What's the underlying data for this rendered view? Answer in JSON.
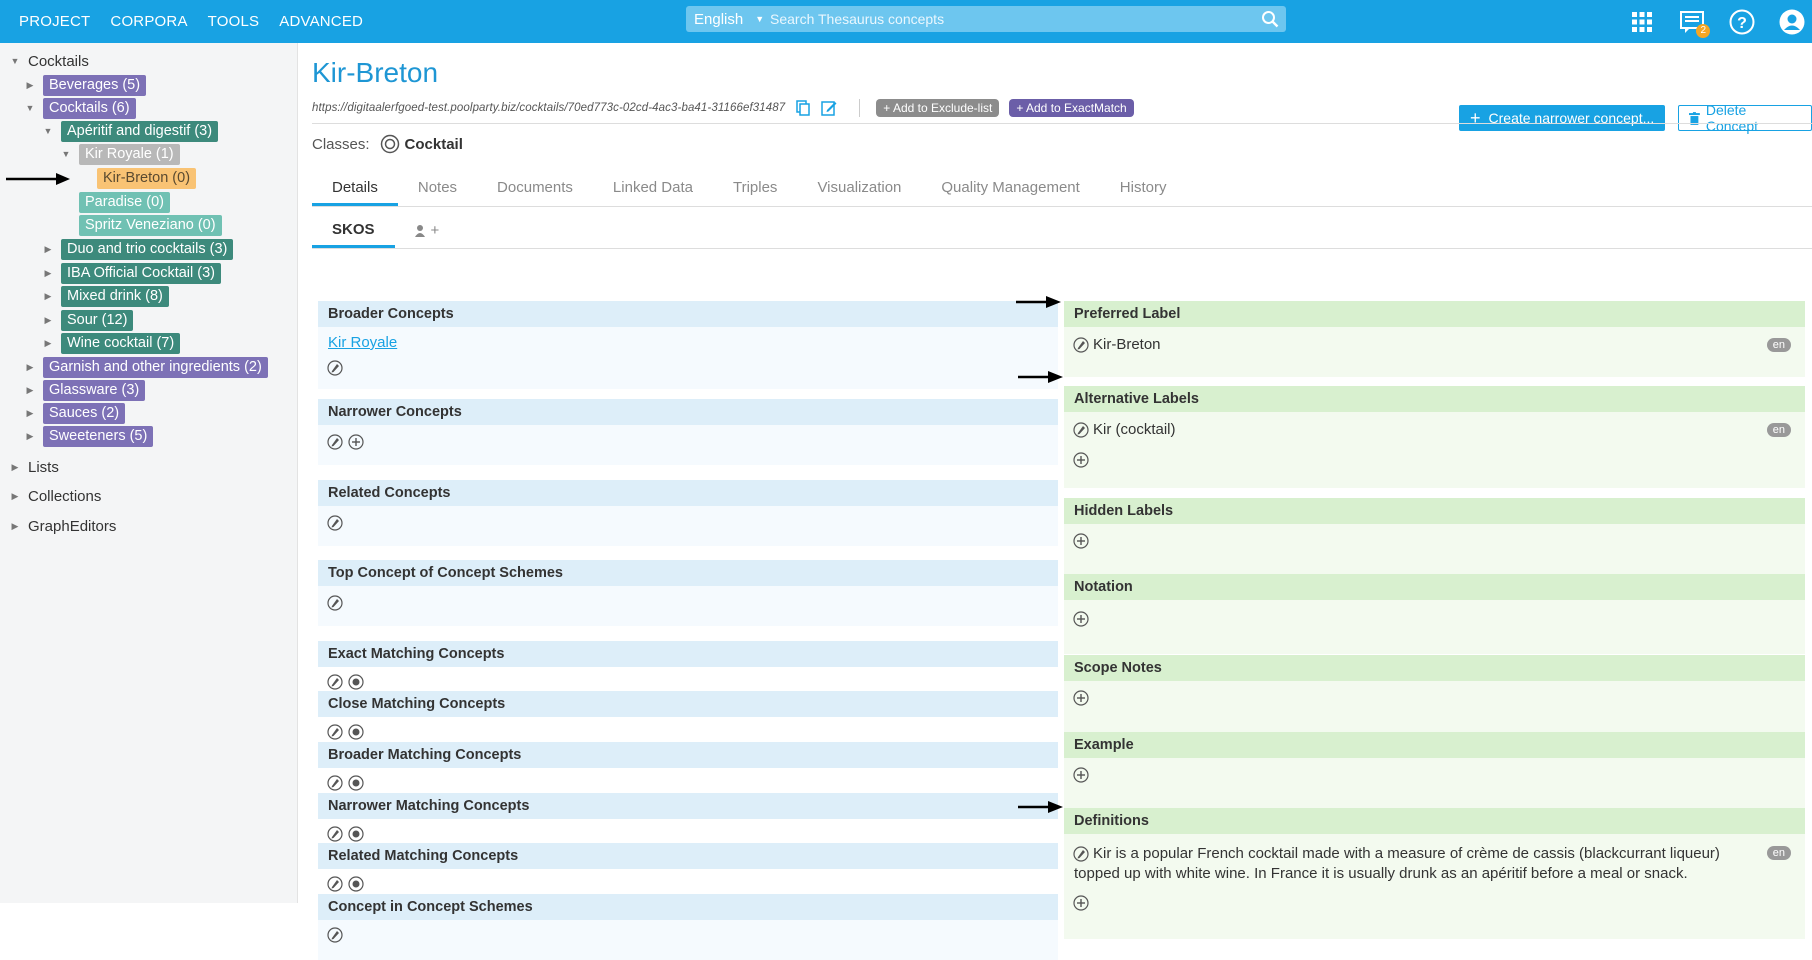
{
  "topnav": [
    "PROJECT",
    "CORPORA",
    "TOOLS",
    "ADVANCED"
  ],
  "search": {
    "language": "English",
    "placeholder": "Search Thesaurus concepts"
  },
  "notifications": {
    "count": "2"
  },
  "icons": {
    "apps": "grid-icon",
    "notifications": "notification-icon",
    "help": "help-icon",
    "user": "user-icon",
    "search": "search-icon"
  },
  "tree": {
    "root": "Cocktails",
    "items": [
      {
        "label": "Beverages (5)"
      },
      {
        "label": "Cocktails (6)"
      },
      {
        "label": "Apéritif and digestif (3)"
      },
      {
        "label": "Kir Royale (1)"
      },
      {
        "label": "Kir-Breton (0)"
      },
      {
        "label": "Paradise (0)"
      },
      {
        "label": "Spritz Veneziano (0)"
      },
      {
        "label": "Duo and trio cocktails (3)"
      },
      {
        "label": "IBA Official Cocktail (3)"
      },
      {
        "label": "Mixed drink (8)"
      },
      {
        "label": "Sour (12)"
      },
      {
        "label": "Wine cocktail (7)"
      },
      {
        "label": "Garnish and other ingredients (2)"
      },
      {
        "label": "Glassware (3)"
      },
      {
        "label": "Sauces (2)"
      },
      {
        "label": "Sweeteners (5)"
      }
    ],
    "sections": [
      "Lists",
      "Collections",
      "GraphEditors"
    ]
  },
  "concept": {
    "title": "Kir-Breton",
    "uri": "https://digitaalerfgoed-test.poolparty.biz/cocktails/70ed773c-02cd-4ac3-ba41-31166ef31487",
    "exclude_label": "+ Add to Exclude-list",
    "exactmatch_label": "+ Add to ExactMatch",
    "classes_label": "Classes:",
    "class_value": "Cocktail",
    "create_button": "Create narrower concept...",
    "delete_button": "Delete Concept"
  },
  "tabs": [
    "Details",
    "Notes",
    "Documents",
    "Linked Data",
    "Triples",
    "Visualization",
    "Quality Management",
    "History"
  ],
  "subtabs": {
    "skos": "SKOS",
    "custom": "+"
  },
  "left_panels": {
    "broader": {
      "title": "Broader Concepts",
      "link": "Kir Royale"
    },
    "narrower": {
      "title": "Narrower Concepts"
    },
    "related": {
      "title": "Related Concepts"
    },
    "top_concept": {
      "title": "Top Concept of Concept Schemes"
    },
    "exact_match": {
      "title": "Exact Matching Concepts"
    },
    "close_match": {
      "title": "Close Matching Concepts"
    },
    "broader_match": {
      "title": "Broader Matching Concepts"
    },
    "narrower_match": {
      "title": "Narrower Matching Concepts"
    },
    "related_match": {
      "title": "Related Matching Concepts"
    },
    "in_scheme": {
      "title": "Concept in Concept Schemes"
    }
  },
  "right_panels": {
    "pref_label": {
      "title": "Preferred Label",
      "value": "Kir-Breton",
      "lang": "en"
    },
    "alt_labels": {
      "title": "Alternative Labels",
      "value": "Kir (cocktail)",
      "lang": "en"
    },
    "hidden_labels": {
      "title": "Hidden Labels"
    },
    "notation": {
      "title": "Notation"
    },
    "scope_notes": {
      "title": "Scope Notes"
    },
    "example": {
      "title": "Example"
    },
    "definitions": {
      "title": "Definitions",
      "line1": "Kir is a popular French cocktail made with a measure of crème de cassis (blackcurrant liqueur)",
      "line2": "topped up with white wine. In France it is usually drunk as an apéritif before a meal or snack.",
      "lang": "en"
    }
  },
  "colors": {
    "accent": "#18a2e3",
    "selected_node": "#f9c374"
  }
}
